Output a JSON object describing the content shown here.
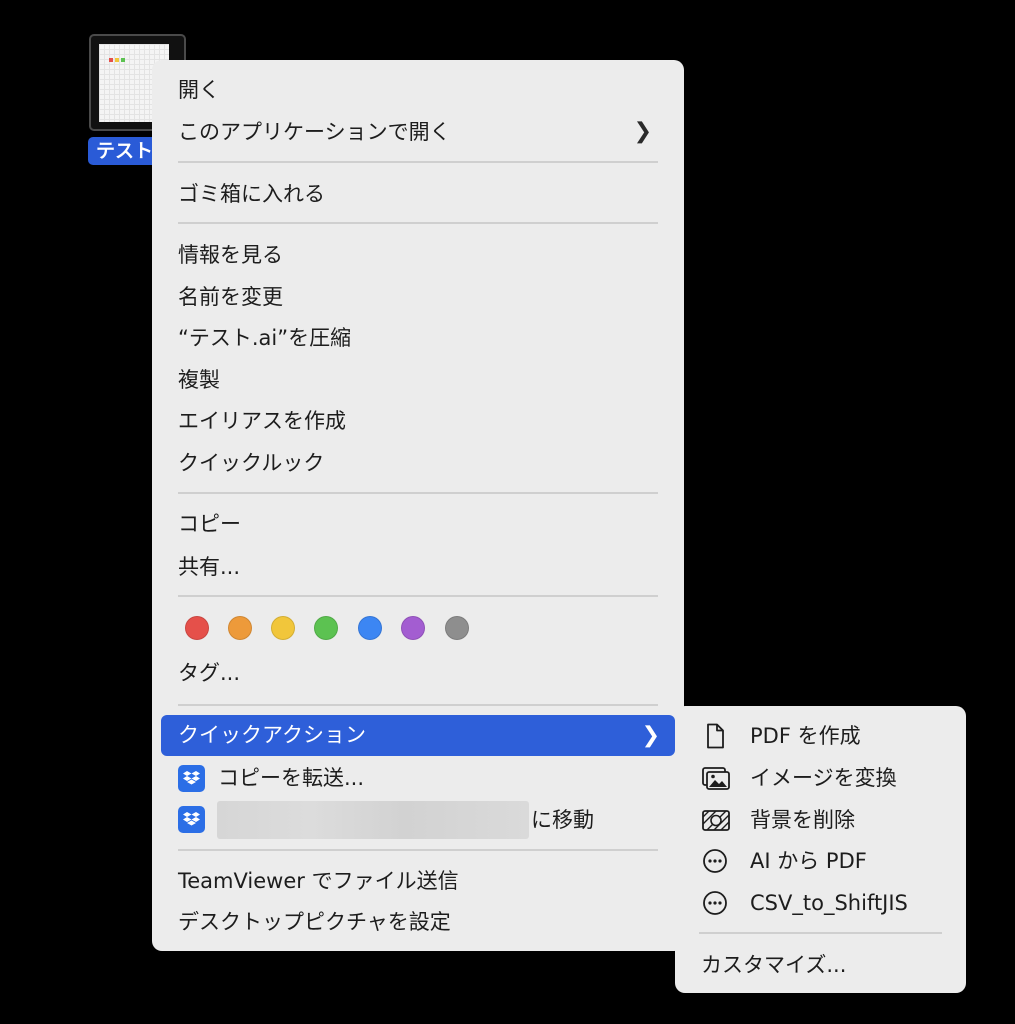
{
  "desktop": {
    "file_label": "テスト.ai"
  },
  "menu": {
    "open": "開く",
    "open_with": "このアプリケーションで開く",
    "move_to_trash": "ゴミ箱に入れる",
    "get_info": "情報を見る",
    "rename": "名前を変更",
    "compress": "“テスト.ai”を圧縮",
    "duplicate": "複製",
    "make_alias": "エイリアスを作成",
    "quick_look": "クイックルック",
    "copy": "コピー",
    "share": "共有...",
    "tag_colors": [
      "#e5504a",
      "#ed9a3a",
      "#f1c63b",
      "#5cc251",
      "#3c86f3",
      "#a35dd1",
      "#8e8e8e"
    ],
    "tags": "タグ...",
    "quick_actions": "クイックアクション",
    "dropbox_send_copy": "コピーを転送...",
    "dropbox_move_suffix": "に移動",
    "teamviewer_send": "TeamViewer でファイル送信",
    "set_desktop_picture": "デスクトップピクチャを設定"
  },
  "submenu": {
    "create_pdf": "PDF を作成",
    "convert_image": "イメージを変換",
    "remove_background": "背景を削除",
    "ai_to_pdf": "AI から PDF",
    "csv_to_shiftjis": "CSV_to_ShiftJIS",
    "customize": "カスタマイズ..."
  },
  "icons": {
    "chevron": "chevron-right-icon",
    "dropbox": "dropbox-icon",
    "document": "document-icon",
    "photo": "photo-icon",
    "remove_bg": "remove-background-icon",
    "more": "ellipsis-circle-icon"
  },
  "colors": {
    "menu_bg": "#ececec",
    "highlight": "#2e5fd9",
    "selection_label": "#2a5bd7",
    "dropbox_blue": "#2b6ee6"
  }
}
